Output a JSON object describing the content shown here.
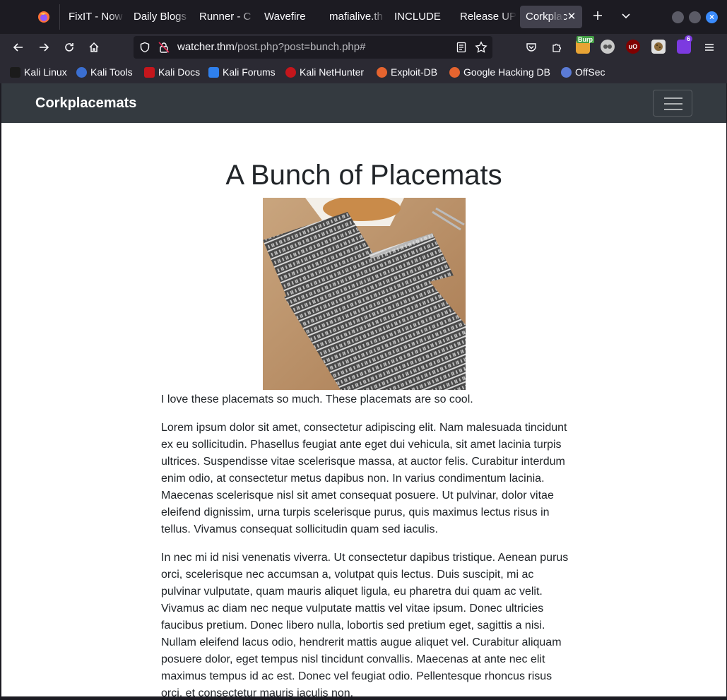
{
  "browser": {
    "tabs": [
      {
        "label": "FixIT - Now"
      },
      {
        "label": "Daily Blogs"
      },
      {
        "label": "Runner - C"
      },
      {
        "label": "Wavefire"
      },
      {
        "label": "mafialive.th"
      },
      {
        "label": "INCLUDE"
      },
      {
        "label": "Release UP"
      },
      {
        "label": "Corkplac"
      }
    ],
    "new_tab_icon": "plus-icon",
    "tab_list_icon": "chevron-down-icon",
    "address": {
      "domain": "watcher.thm",
      "path": "/post.php?post=bunch.php#"
    },
    "extension_badges": {
      "burp": "Burp",
      "notifications": "6"
    },
    "bookmarks": [
      {
        "label": "Kali Linux",
        "color": "#1b1b1b"
      },
      {
        "label": "Kali Tools",
        "color": "#3b6fd1"
      },
      {
        "label": "Kali Docs",
        "color": "#c4161c"
      },
      {
        "label": "Kali Forums",
        "color": "#2f80ed"
      },
      {
        "label": "Kali NetHunter",
        "color": "#c4161c"
      },
      {
        "label": "Exploit-DB",
        "color": "#e5642f"
      },
      {
        "label": "Google Hacking DB",
        "color": "#e5642f"
      },
      {
        "label": "OffSec",
        "color": "#5b7bd5"
      }
    ]
  },
  "site": {
    "brand": "Corkplacemats",
    "post": {
      "title": "A Bunch of Placemats",
      "paragraphs": [
        "I love these placemats so much. These placemats are so cool.",
        "Lorem ipsum dolor sit amet, consectetur adipiscing elit. Nam malesuada tincidunt ex eu sollicitudin. Phasellus feugiat ante eget dui vehicula, sit amet lacinia turpis ultrices. Suspendisse vitae scelerisque massa, at auctor felis. Curabitur interdum enim odio, at consectetur metus dapibus non. In varius condimentum lacinia. Maecenas scelerisque nisl sit amet consequat posuere. Ut pulvinar, dolor vitae eleifend dignissim, urna turpis scelerisque purus, quis maximus lectus risus in tellus. Vivamus consequat sollicitudin quam sed iaculis.",
        "In nec mi id nisi venenatis viverra. Ut consectetur dapibus tristique. Aenean purus orci, scelerisque nec accumsan a, volutpat quis lectus. Duis suscipit, mi ac pulvinar vulputate, quam mauris aliquet ligula, eu pharetra dui quam ac velit. Vivamus ac diam nec neque vulputate mattis vel vitae ipsum. Donec ultricies faucibus pretium. Donec libero nulla, lobortis sed pretium eget, sagittis a nisi. Nullam eleifend lacus odio, hendrerit mattis augue aliquet vel. Curabitur aliquam posuere dolor, eget tempus nisl tincidunt convallis. Maecenas at ante nec elit maximus tempus id ac est. Donec vel feugiat odio. Pellentesque rhoncus risus orci, et consectetur mauris iaculis non."
      ]
    }
  }
}
